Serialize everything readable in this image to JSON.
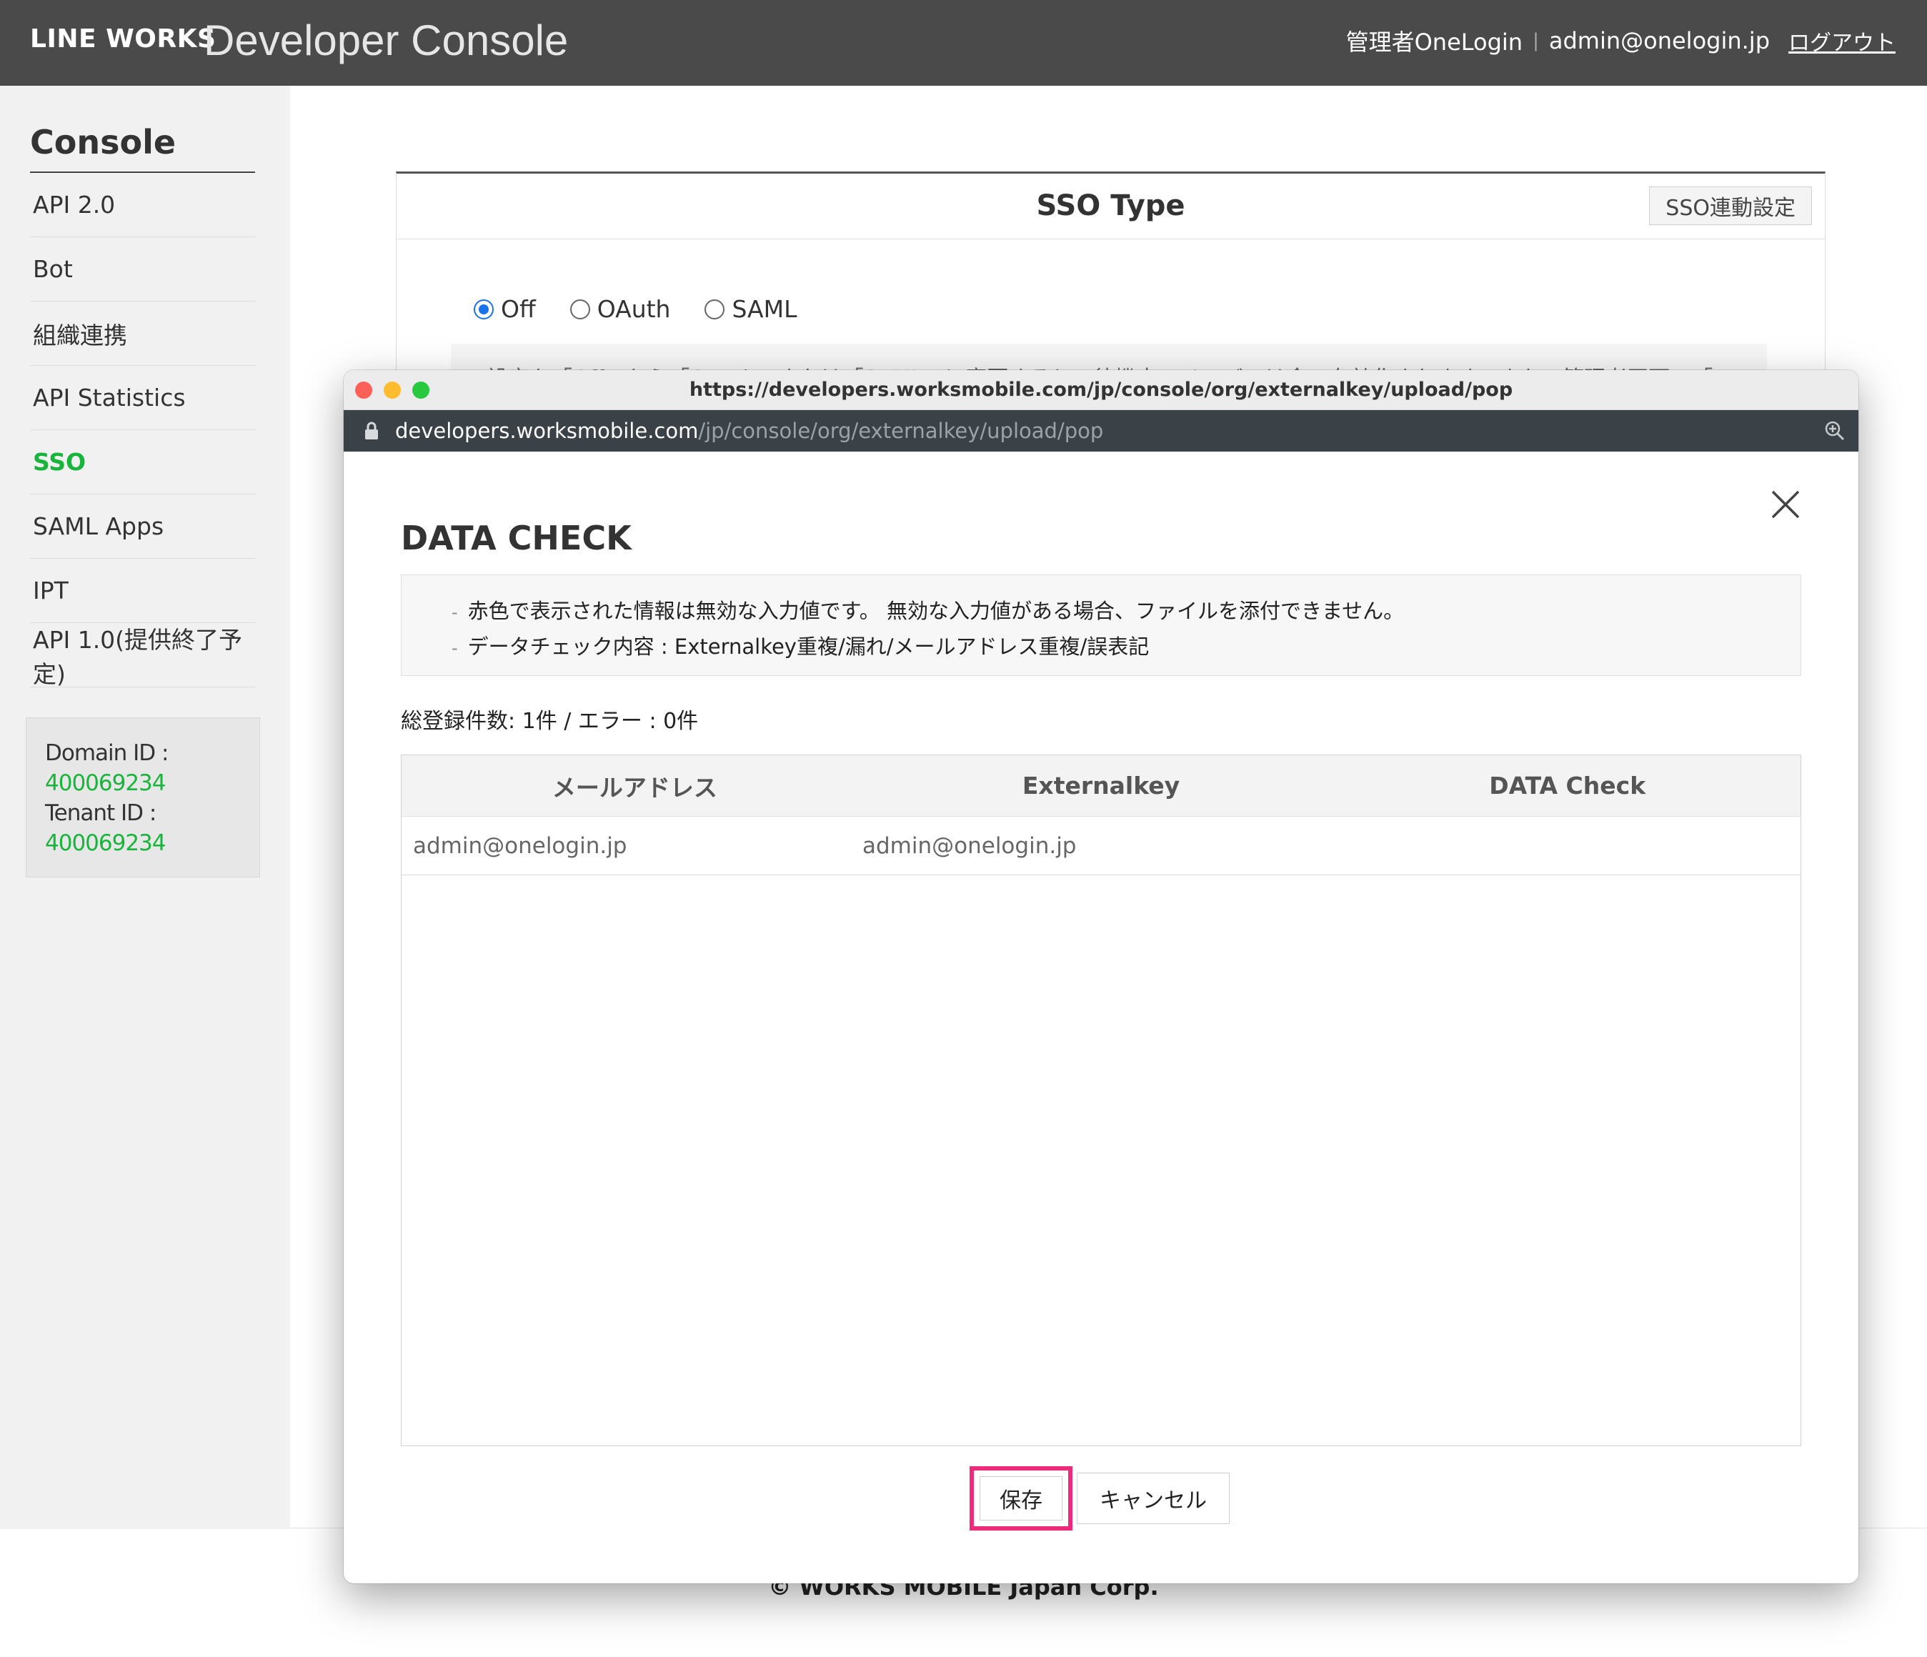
{
  "header": {
    "brand": "LINE WORKS",
    "product": "Developer Console",
    "user_name": "管理者OneLogin",
    "separator": "|",
    "user_email": "admin@onelogin.jp",
    "logout_label": "ログアウト"
  },
  "sidebar": {
    "title": "Console",
    "items": [
      {
        "label": "API 2.0"
      },
      {
        "label": "Bot"
      },
      {
        "label": "組織連携"
      },
      {
        "label": "API Statistics"
      },
      {
        "label": "SSO"
      },
      {
        "label": "SAML Apps"
      },
      {
        "label": "IPT"
      },
      {
        "label": "API 1.0(提供終了予定)"
      }
    ],
    "active_item": "SSO",
    "domain_id_label": "Domain ID :",
    "domain_id": "400069234",
    "tenant_id_label": "Tenant ID :",
    "tenant_id": "400069234"
  },
  "sso_panel": {
    "title": "SSO Type",
    "link_button": "SSO連動設定",
    "options": [
      {
        "label": "Off",
        "checked": true
      },
      {
        "label": "OAuth",
        "checked": false
      },
      {
        "label": "SAML",
        "checked": false
      }
    ],
    "note_partial": "設定を「Off」から「OAuth」または「SAML」に変更すると、待機中のメンバーは全て有効化されます。また、管理者画面で「U"
  },
  "footer": {
    "copyright": "© WORKS MOBILE Japan Corp."
  },
  "popup": {
    "window_url": "https://developers.worksmobile.com/jp/console/org/externalkey/upload/pop",
    "address_host": "developers.worksmobile.com",
    "address_path": "/jp/console/org/externalkey/upload/pop",
    "title": "DATA CHECK",
    "info_lines": [
      "赤色で表示された情報は無効な入力値です。 無効な入力値がある場合、ファイルを添付できません。",
      "データチェック内容 : Externalkey重複/漏れ/メールアドレス重複/誤表記"
    ],
    "summary": "総登録件数: 1件 / エラー : 0件",
    "table": {
      "columns": [
        "メールアドレス",
        "Externalkey",
        "DATA Check"
      ],
      "rows": [
        [
          "admin@onelogin.jp",
          "admin@onelogin.jp",
          ""
        ]
      ]
    },
    "save_label": "保存",
    "cancel_label": "キャンセル",
    "colors": {
      "highlight": "#ee2a7b",
      "accent_green": "#19b43b",
      "radio_blue": "#1a73e8"
    }
  }
}
